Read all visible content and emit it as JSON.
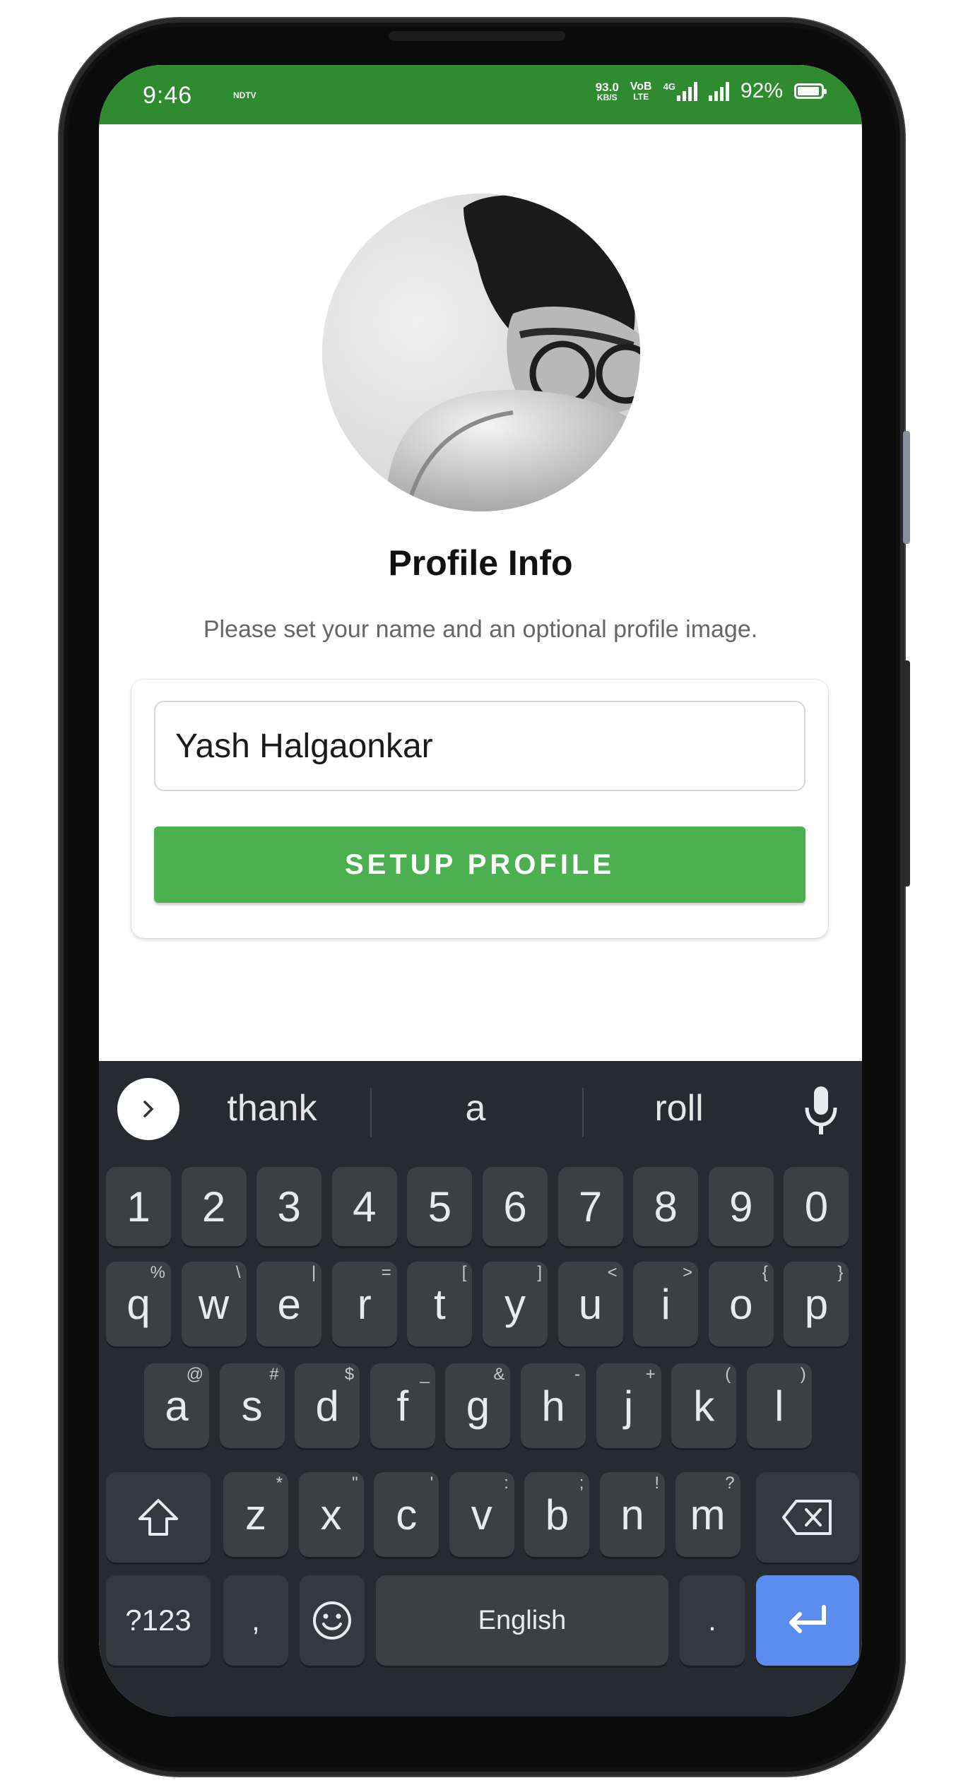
{
  "status_bar": {
    "time": "9:46",
    "carrier_logo": "NDTV",
    "net_speed_value": "93.0",
    "net_speed_unit": "KB/S",
    "volte_top": "VoB",
    "volte_bottom": "LTE",
    "network_type": "4G",
    "battery_percent": "92%"
  },
  "profile": {
    "title": "Profile Info",
    "subtitle": "Please set your name and an optional profile image.",
    "name_value": "Yash Halgaonkar",
    "setup_button": "SETUP PROFILE"
  },
  "keyboard": {
    "suggestions": [
      "thank",
      "a",
      "roll"
    ],
    "number_row": [
      "1",
      "2",
      "3",
      "4",
      "5",
      "6",
      "7",
      "8",
      "9",
      "0"
    ],
    "row1": [
      {
        "key": "q",
        "sup": "%"
      },
      {
        "key": "w",
        "sup": "\\"
      },
      {
        "key": "e",
        "sup": "|"
      },
      {
        "key": "r",
        "sup": "="
      },
      {
        "key": "t",
        "sup": "["
      },
      {
        "key": "y",
        "sup": "]"
      },
      {
        "key": "u",
        "sup": "<"
      },
      {
        "key": "i",
        "sup": ">"
      },
      {
        "key": "o",
        "sup": "{"
      },
      {
        "key": "p",
        "sup": "}"
      }
    ],
    "row2": [
      {
        "key": "a",
        "sup": "@"
      },
      {
        "key": "s",
        "sup": "#"
      },
      {
        "key": "d",
        "sup": "$"
      },
      {
        "key": "f",
        "sup": "_"
      },
      {
        "key": "g",
        "sup": "&"
      },
      {
        "key": "h",
        "sup": "-"
      },
      {
        "key": "j",
        "sup": "+"
      },
      {
        "key": "k",
        "sup": "("
      },
      {
        "key": "l",
        "sup": ")"
      }
    ],
    "row3": [
      {
        "key": "z",
        "sup": "*"
      },
      {
        "key": "x",
        "sup": "\""
      },
      {
        "key": "c",
        "sup": "'"
      },
      {
        "key": "v",
        "sup": ":"
      },
      {
        "key": "b",
        "sup": ";"
      },
      {
        "key": "n",
        "sup": "!"
      },
      {
        "key": "m",
        "sup": "?"
      }
    ],
    "symbols_key": "?123",
    "comma_key": ",",
    "space_label": "English",
    "period_key": ".",
    "enter_color": "#5b8def"
  },
  "colors": {
    "status_bar": "#2e8b2f",
    "button": "#4caf50",
    "keyboard_bg": "#272a2f",
    "key_bg": "#3c4043"
  }
}
